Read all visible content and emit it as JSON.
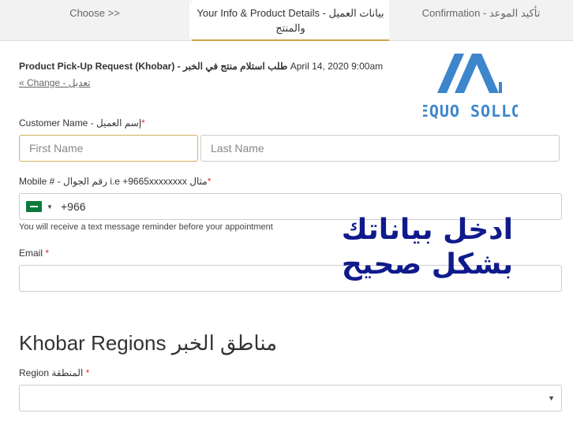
{
  "steps": {
    "choose": "Choose >>",
    "info_line1": "Your Info & Product Details - بيانات العميل",
    "info_line2": "والمنتج",
    "confirm": "Confirmation - تأكيد الموعد"
  },
  "summary": {
    "title": "Product Pick-Up Request (Khobar) - طلب استلام منتج في الخبر",
    "datetime": "April 14, 2020 9:00am",
    "change": "« Change - تعديل"
  },
  "customer": {
    "label": "Customer Name - إسم العميل",
    "required": "*",
    "first_placeholder": "First Name",
    "last_placeholder": "Last Name"
  },
  "mobile": {
    "label": "Mobile # - رقم الجوال i.e +9665xxxxxxxx مثال",
    "required": "*",
    "country_code": "+966",
    "hint": "You will receive a text message reminder before your appointment"
  },
  "email": {
    "label": "Email",
    "required": "*"
  },
  "overlay": {
    "line1": "ادخل بياناتك",
    "line2": "بشكل صحيح"
  },
  "regions": {
    "title": "Khobar Regions مناطق الخبر",
    "label": "Region المنطقة",
    "required": "*"
  },
  "logo": {
    "text": "EQUO SOLLO",
    "color": "#3d86cc"
  },
  "colors": {
    "accent": "#c9a24a",
    "overlay_text": "#0f1a8c",
    "required": "#dd3333"
  }
}
